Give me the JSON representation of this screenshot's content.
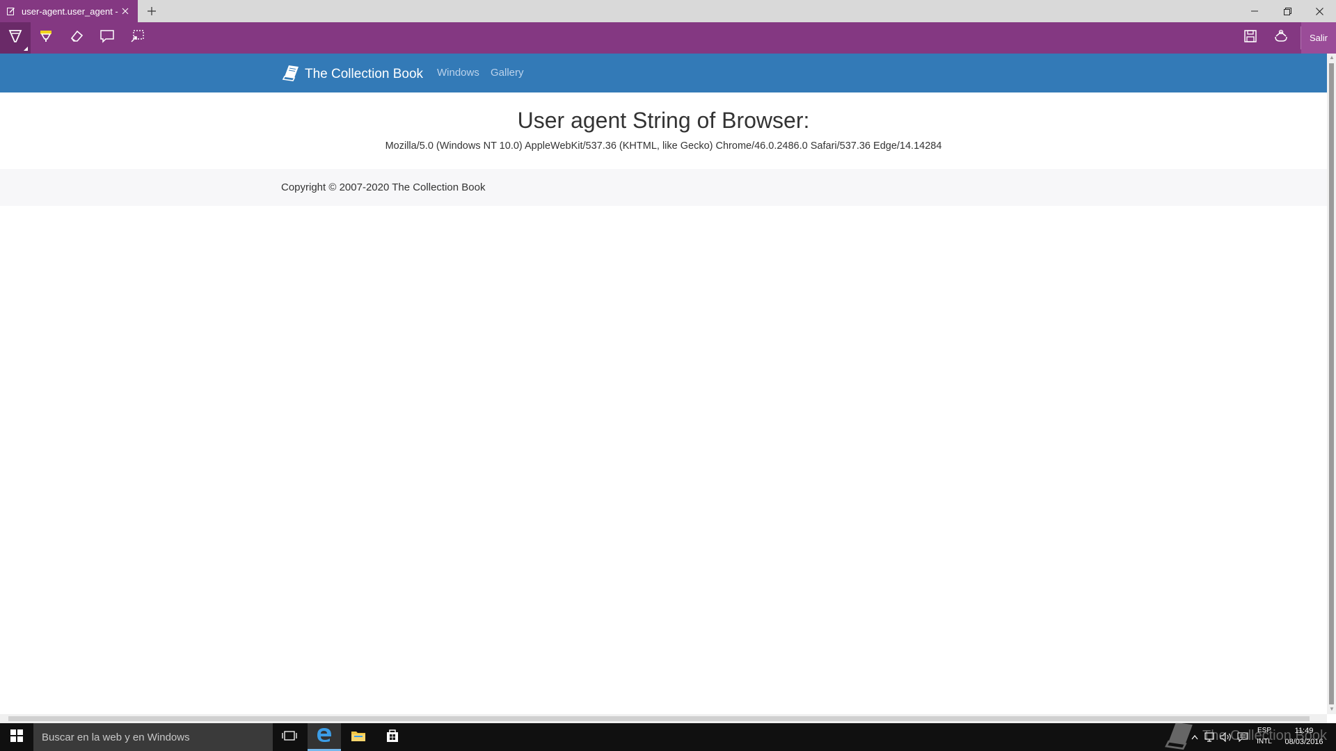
{
  "browser": {
    "tab_title": "user-agent.user_agent -",
    "exit_label": "Salir",
    "tools": [
      "pen-icon",
      "highlighter-icon",
      "eraser-icon",
      "comment-icon",
      "clip-icon"
    ],
    "actions": [
      "save-icon",
      "share-icon"
    ]
  },
  "site": {
    "brand": "The Collection Book",
    "nav": [
      "Windows",
      "Gallery"
    ],
    "heading": "User agent String of Browser:",
    "user_agent": "Mozilla/5.0 (Windows NT 10.0) AppleWebKit/537.36 (KHTML, like Gecko) Chrome/46.0.2486.0 Safari/537.36 Edge/14.14284",
    "copyright": "Copyright © 2007-2020 The Collection Book"
  },
  "taskbar": {
    "search_placeholder": "Buscar en la web y en Windows",
    "lang_top": "ESP",
    "lang_bottom": "INTL",
    "time": "11:49",
    "date": "08/03/2016"
  },
  "watermark": "The Collection Book",
  "colors": {
    "toolbar": "#843882",
    "navbar": "#337ab7",
    "taskbar": "#101010"
  }
}
